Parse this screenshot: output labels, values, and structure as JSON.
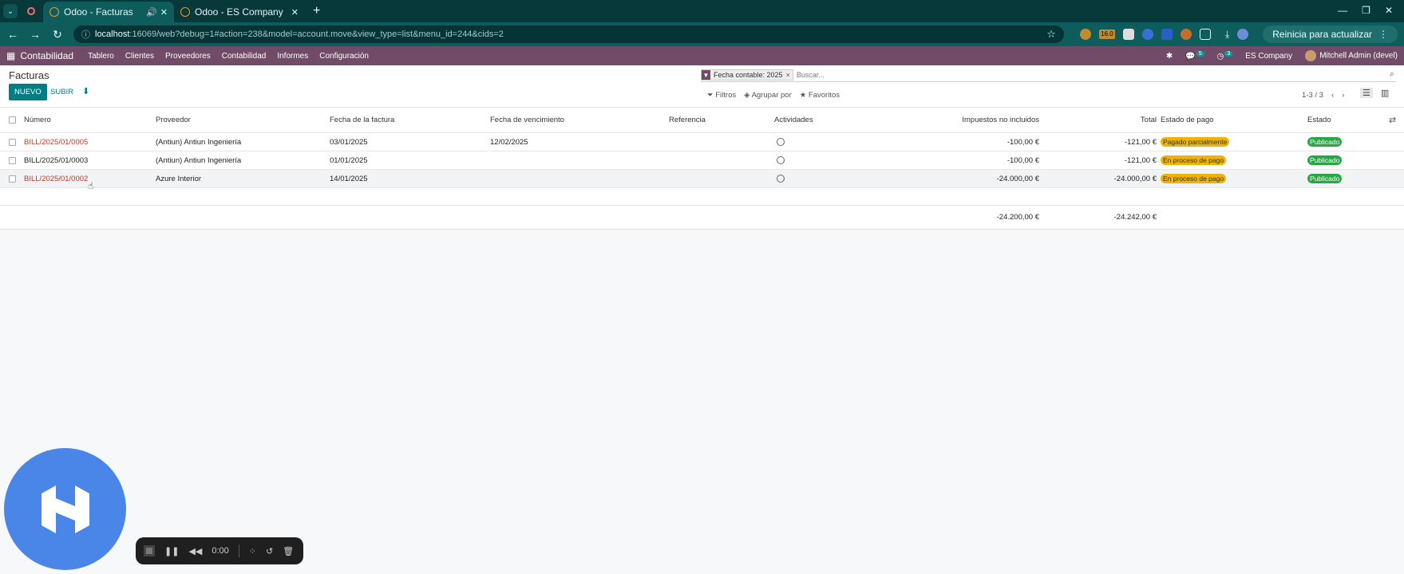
{
  "browser": {
    "tabs": [
      {
        "title": "Odoo - Facturas",
        "active": true
      },
      {
        "title": "Odoo - ES Company",
        "active": false
      }
    ],
    "url_host": "localhost",
    "url_rest": ":16069/web?debug=1#action=238&model=account.move&view_type=list&menu_id=244&cids=2",
    "extension_badge": "16.0",
    "update_label": "Reinicia para actualizar"
  },
  "odoo_nav": {
    "app_name": "Contabilidad",
    "menu": [
      "Tablero",
      "Clientes",
      "Proveedores",
      "Contabilidad",
      "Informes",
      "Configuración"
    ],
    "messages_count": "5",
    "activities_count": "3",
    "company": "ES Company",
    "user": "Mitchell Admin (devel)"
  },
  "control": {
    "title": "Facturas",
    "new_label": "NUEVO",
    "upload_label": "SUBIR",
    "facet_text": "Fecha contable: 2025",
    "search_placeholder": "Buscar...",
    "filters_label": "Filtros",
    "group_label": "Agrupar por",
    "favorites_label": "Favoritos",
    "pager": "1-3 / 3"
  },
  "table": {
    "columns": {
      "number": "Número",
      "vendor": "Proveedor",
      "invoice_date": "Fecha de la factura",
      "due_date": "Fecha de vencimiento",
      "reference": "Referencia",
      "activities": "Actividades",
      "untaxed": "Impuestos no incluidos",
      "total": "Total",
      "payment_state": "Estado de pago",
      "state": "Estado"
    },
    "rows": [
      {
        "number": "BILL/2025/01/0005",
        "vendor": "(Antiun) Antiun Ingeniería",
        "invoice_date": "03/01/2025",
        "due_date": "12/02/2025",
        "reference": "",
        "untaxed": "-100,00 €",
        "total": "-121,00 €",
        "payment_state": "Pagado parcialmente",
        "state": "Publicado"
      },
      {
        "number": "BILL/2025/01/0003",
        "vendor": "(Antiun) Antiun Ingeniería",
        "invoice_date": "01/01/2025",
        "due_date": "",
        "reference": "",
        "untaxed": "-100,00 €",
        "total": "-121,00 €",
        "payment_state": "En proceso de pago",
        "state": "Publicado"
      },
      {
        "number": "BILL/2025/01/0002",
        "vendor": "Azure Interior",
        "invoice_date": "14/01/2025",
        "due_date": "",
        "reference": "",
        "untaxed": "-24.000,00 €",
        "total": "-24.000,00 €",
        "payment_state": "En proceso de pago",
        "state": "Publicado"
      }
    ],
    "totals": {
      "untaxed": "-24.200,00 €",
      "total": "-24.242,00 €"
    }
  },
  "recorder": {
    "time": "0:00"
  },
  "colors": {
    "odoo_brand": "#714b67",
    "teal": "#017e84",
    "warning": "#f0b400",
    "success": "#28a745",
    "link": "#c0392b"
  }
}
